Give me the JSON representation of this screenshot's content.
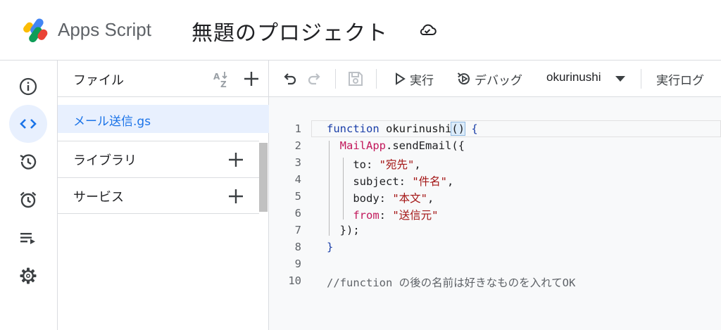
{
  "header": {
    "app_name": "Apps Script",
    "project_title": "無題のプロジェクト"
  },
  "rail": {
    "items": [
      {
        "icon": "info-icon"
      },
      {
        "icon": "code-icon",
        "active": true
      },
      {
        "icon": "history-icon"
      },
      {
        "icon": "alarm-icon"
      },
      {
        "icon": "executions-icon"
      },
      {
        "icon": "gear-icon"
      }
    ]
  },
  "files_panel": {
    "title": "ファイル",
    "files": [
      {
        "name": "メール送信.gs"
      }
    ],
    "sections": [
      {
        "label": "ライブラリ"
      },
      {
        "label": "サービス"
      }
    ]
  },
  "toolbar": {
    "run_label": "実行",
    "debug_label": "デバッグ",
    "function_select": "okurinushi",
    "log_label": "実行ログ"
  },
  "editor": {
    "lines": [
      {
        "n": "1",
        "tokens": [
          {
            "t": "function",
            "c": "kw"
          },
          {
            "t": " okurinushi",
            "c": "fn"
          },
          {
            "t": "()",
            "c": "plain",
            "hl": true
          },
          {
            "t": " {",
            "c": "kw"
          }
        ]
      },
      {
        "n": "2",
        "tokens": [
          {
            "t": "  ",
            "c": "plain"
          },
          {
            "t": "MailApp",
            "c": "cls"
          },
          {
            "t": ".sendEmail({",
            "c": "plain"
          }
        ]
      },
      {
        "n": "3",
        "tokens": [
          {
            "t": "    to: ",
            "c": "plain"
          },
          {
            "t": "\"宛先\"",
            "c": "str"
          },
          {
            "t": ",",
            "c": "plain"
          }
        ]
      },
      {
        "n": "4",
        "tokens": [
          {
            "t": "    subject: ",
            "c": "plain"
          },
          {
            "t": "\"件名\"",
            "c": "str"
          },
          {
            "t": ",",
            "c": "plain"
          }
        ]
      },
      {
        "n": "5",
        "tokens": [
          {
            "t": "    body: ",
            "c": "plain"
          },
          {
            "t": "\"本文\"",
            "c": "str"
          },
          {
            "t": ",",
            "c": "plain"
          }
        ]
      },
      {
        "n": "6",
        "tokens": [
          {
            "t": "    ",
            "c": "plain"
          },
          {
            "t": "from",
            "c": "cls"
          },
          {
            "t": ": ",
            "c": "plain"
          },
          {
            "t": "\"送信元\"",
            "c": "str"
          }
        ]
      },
      {
        "n": "7",
        "tokens": [
          {
            "t": "  });",
            "c": "plain"
          }
        ]
      },
      {
        "n": "8",
        "tokens": [
          {
            "t": "}",
            "c": "kw"
          }
        ]
      },
      {
        "n": "9",
        "tokens": []
      },
      {
        "n": "10",
        "tokens": [
          {
            "t": "//function の後の名前は好きなものを入れてOK",
            "c": "cmt"
          }
        ]
      }
    ]
  }
}
